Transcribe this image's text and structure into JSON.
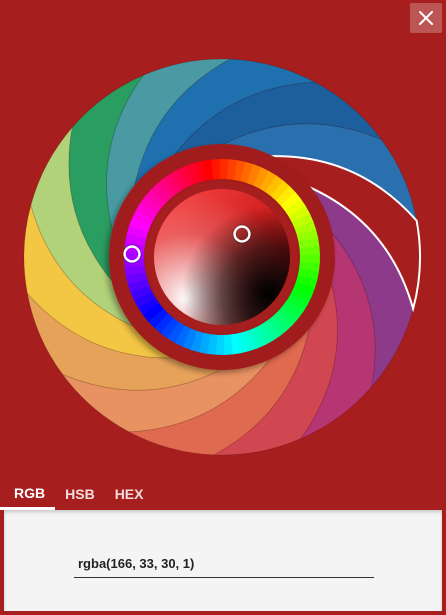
{
  "window": {
    "close_icon": "close-icon"
  },
  "colors": {
    "background": "#a61e1d",
    "panel": "#f4f4f4",
    "selected": "#a6211e"
  },
  "picker": {
    "selected_rgba": {
      "r": 166,
      "g": 33,
      "b": 30,
      "a": 1
    }
  },
  "tabs": [
    {
      "label": "RGB",
      "active": true
    },
    {
      "label": "HSB",
      "active": false
    },
    {
      "label": "HEX",
      "active": false
    }
  ],
  "output": {
    "value": "rgba(166, 33, 30, 1)"
  }
}
